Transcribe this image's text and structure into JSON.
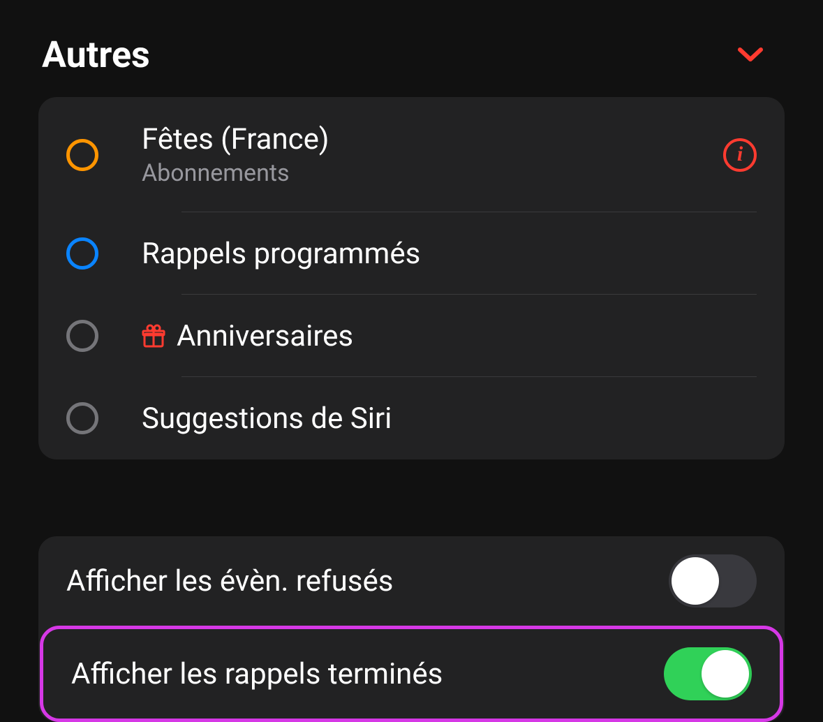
{
  "header": {
    "title": "Autres"
  },
  "calendars": [
    {
      "title": "Fêtes (France)",
      "subtitle": "Abonnements",
      "color": "orange",
      "has_info": true,
      "has_icon": false
    },
    {
      "title": "Rappels programmés",
      "subtitle": "",
      "color": "blue",
      "has_info": false,
      "has_icon": false
    },
    {
      "title": "Anniversaires",
      "subtitle": "",
      "color": "gray",
      "has_info": false,
      "has_icon": true,
      "icon": "gift"
    },
    {
      "title": "Suggestions de Siri",
      "subtitle": "",
      "color": "gray",
      "has_info": false,
      "has_icon": false
    }
  ],
  "toggles": {
    "declined_events": {
      "label": "Afficher les évèn. refusés",
      "value": false
    },
    "completed_reminders": {
      "label": "Afficher les rappels terminés",
      "value": true,
      "highlighted": true
    }
  }
}
